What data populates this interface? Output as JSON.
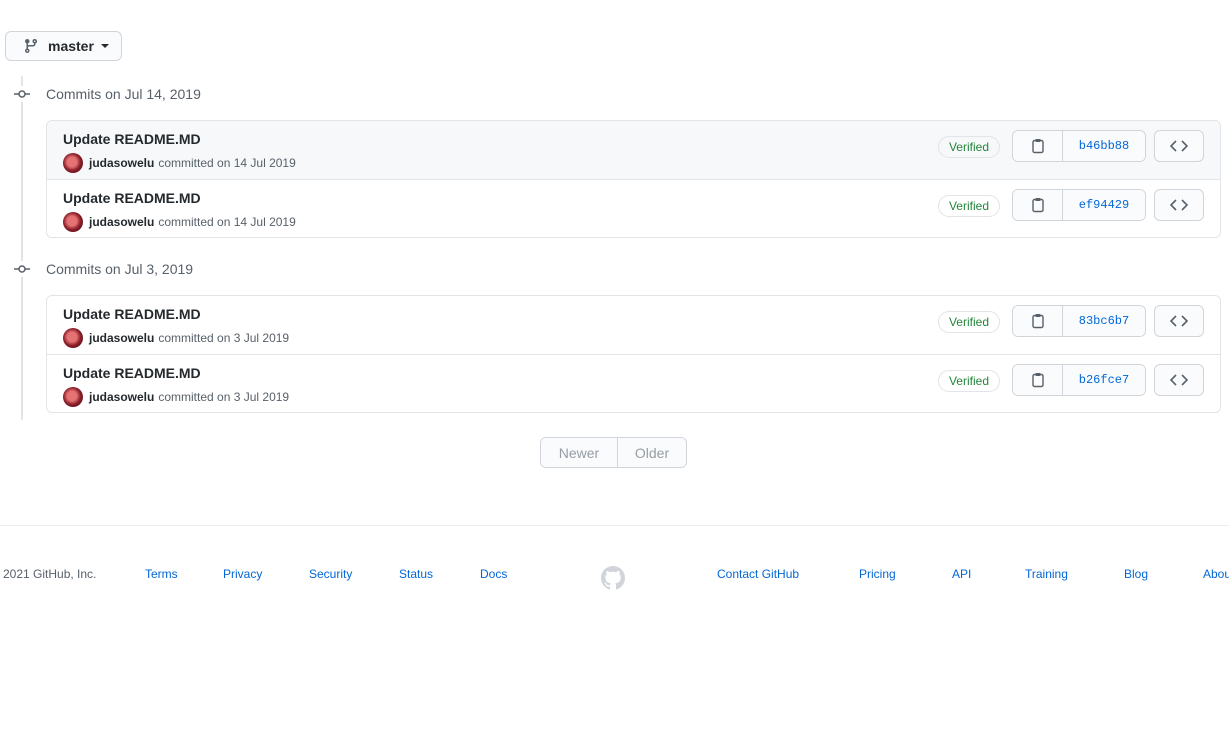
{
  "branch": {
    "name": "master"
  },
  "groups": [
    {
      "title": "Commits on Jul 14, 2019",
      "commits": [
        {
          "message": "Update README.MD",
          "author": "judasowelu",
          "committed": "committed on 14 Jul 2019",
          "verified": "Verified",
          "sha": "b46bb88"
        },
        {
          "message": "Update README.MD",
          "author": "judasowelu",
          "committed": "committed on 14 Jul 2019",
          "verified": "Verified",
          "sha": "ef94429"
        }
      ]
    },
    {
      "title": "Commits on Jul 3, 2019",
      "commits": [
        {
          "message": "Update README.MD",
          "author": "judasowelu",
          "committed": "committed on 3 Jul 2019",
          "verified": "Verified",
          "sha": "83bc6b7"
        },
        {
          "message": "Update README.MD",
          "author": "judasowelu",
          "committed": "committed on 3 Jul 2019",
          "verified": "Verified",
          "sha": "b26fce7"
        }
      ]
    }
  ],
  "pagination": {
    "newer": "Newer",
    "older": "Older"
  },
  "footer": {
    "copyright": "2021 GitHub, Inc.",
    "left_links": [
      "Terms",
      "Privacy",
      "Security",
      "Status",
      "Docs"
    ],
    "right_links": [
      "Contact GitHub",
      "Pricing",
      "API",
      "Training",
      "Blog",
      "About"
    ]
  },
  "icons": {
    "branch": "git-branch-icon",
    "commit_node": "git-commit-icon",
    "copy": "clipboard-icon",
    "browse": "code-icon",
    "logo": "github-mark-icon"
  },
  "colors": {
    "link": "#0366d6",
    "verified": "#22863a",
    "muted": "#586069"
  }
}
